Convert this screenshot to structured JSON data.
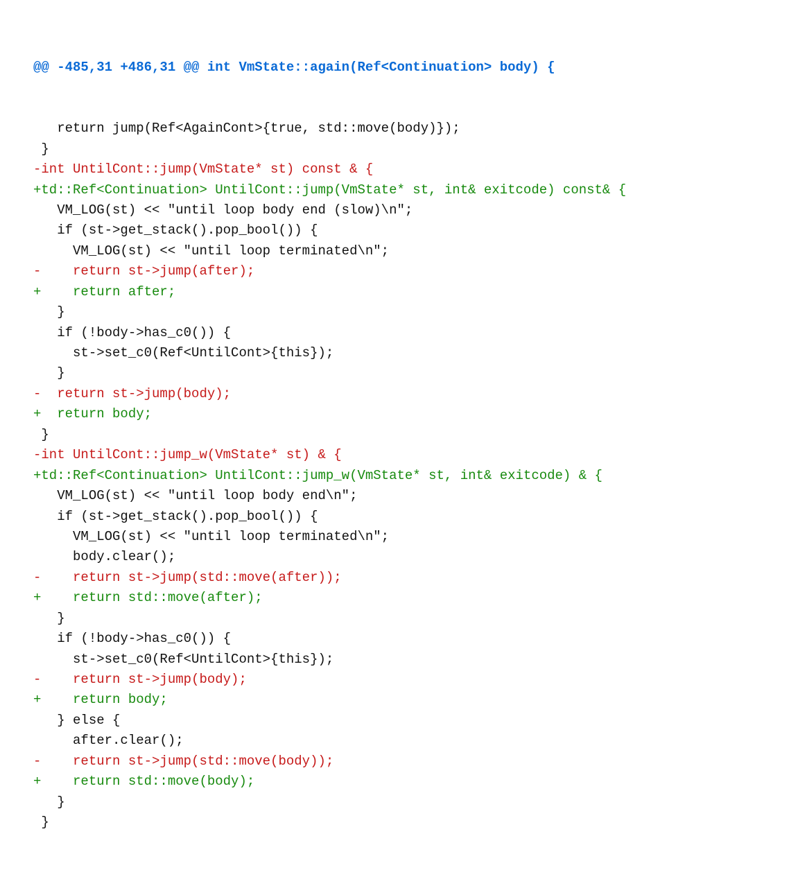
{
  "diff": {
    "hunk_header": {
      "range": "@@ -485,31 +486,31 @@ ",
      "func": "int VmState::again(Ref<Continuation> body) {"
    },
    "lines": [
      {
        "kind": "ctx",
        "text": "   return jump(Ref<AgainCont>{true, std::move(body)});"
      },
      {
        "kind": "ctx",
        "text": " }"
      },
      {
        "kind": "ctx",
        "text": ""
      },
      {
        "kind": "del",
        "text": "-int UntilCont::jump(VmState* st) const & {"
      },
      {
        "kind": "add",
        "text": "+td::Ref<Continuation> UntilCont::jump(VmState* st, int& exitcode) const& {"
      },
      {
        "kind": "ctx",
        "text": "   VM_LOG(st) << \"until loop body end (slow)\\n\";"
      },
      {
        "kind": "ctx",
        "text": "   if (st->get_stack().pop_bool()) {"
      },
      {
        "kind": "ctx",
        "text": "     VM_LOG(st) << \"until loop terminated\\n\";"
      },
      {
        "kind": "del",
        "text": "-    return st->jump(after);"
      },
      {
        "kind": "add",
        "text": "+    return after;"
      },
      {
        "kind": "ctx",
        "text": "   }"
      },
      {
        "kind": "ctx",
        "text": "   if (!body->has_c0()) {"
      },
      {
        "kind": "ctx",
        "text": "     st->set_c0(Ref<UntilCont>{this});"
      },
      {
        "kind": "ctx",
        "text": "   }"
      },
      {
        "kind": "del",
        "text": "-  return st->jump(body);"
      },
      {
        "kind": "add",
        "text": "+  return body;"
      },
      {
        "kind": "ctx",
        "text": " }"
      },
      {
        "kind": "ctx",
        "text": ""
      },
      {
        "kind": "del",
        "text": "-int UntilCont::jump_w(VmState* st) & {"
      },
      {
        "kind": "add",
        "text": "+td::Ref<Continuation> UntilCont::jump_w(VmState* st, int& exitcode) & {"
      },
      {
        "kind": "ctx",
        "text": "   VM_LOG(st) << \"until loop body end\\n\";"
      },
      {
        "kind": "ctx",
        "text": "   if (st->get_stack().pop_bool()) {"
      },
      {
        "kind": "ctx",
        "text": "     VM_LOG(st) << \"until loop terminated\\n\";"
      },
      {
        "kind": "ctx",
        "text": "     body.clear();"
      },
      {
        "kind": "del",
        "text": "-    return st->jump(std::move(after));"
      },
      {
        "kind": "add",
        "text": "+    return std::move(after);"
      },
      {
        "kind": "ctx",
        "text": "   }"
      },
      {
        "kind": "ctx",
        "text": "   if (!body->has_c0()) {"
      },
      {
        "kind": "ctx",
        "text": "     st->set_c0(Ref<UntilCont>{this});"
      },
      {
        "kind": "del",
        "text": "-    return st->jump(body);"
      },
      {
        "kind": "add",
        "text": "+    return body;"
      },
      {
        "kind": "ctx",
        "text": "   } else {"
      },
      {
        "kind": "ctx",
        "text": "     after.clear();"
      },
      {
        "kind": "del",
        "text": "-    return st->jump(std::move(body));"
      },
      {
        "kind": "add",
        "text": "+    return std::move(body);"
      },
      {
        "kind": "ctx",
        "text": "   }"
      },
      {
        "kind": "ctx",
        "text": " }"
      }
    ]
  }
}
